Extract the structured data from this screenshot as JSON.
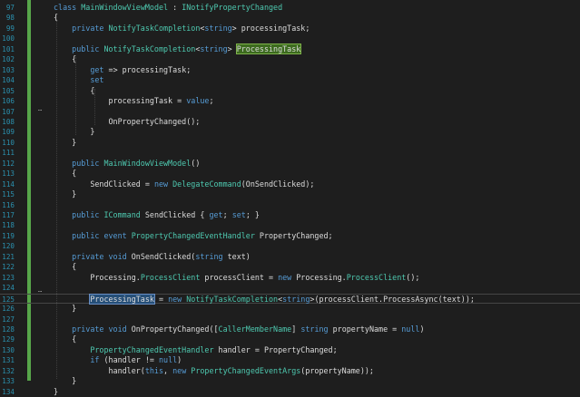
{
  "editor": {
    "lines": [
      {
        "n": "97",
        "tokens": [
          [
            "kw",
            "class "
          ],
          [
            "ty",
            "MainWindowViewModel"
          ],
          [
            "pl",
            " : "
          ],
          [
            "ty",
            "INotifyPropertyChanged"
          ]
        ]
      },
      {
        "n": "98",
        "tokens": [
          [
            "pl",
            "{"
          ]
        ]
      },
      {
        "n": "99",
        "tokens": [
          [
            "pl",
            "    "
          ],
          [
            "kw",
            "private "
          ],
          [
            "ty",
            "NotifyTaskCompletion"
          ],
          [
            "pl",
            "<"
          ],
          [
            "kw",
            "string"
          ],
          [
            "pl",
            "> processingTask;"
          ]
        ]
      },
      {
        "n": "100",
        "tokens": []
      },
      {
        "n": "101",
        "tokens": [
          [
            "pl",
            "    "
          ],
          [
            "kw",
            "public "
          ],
          [
            "ty",
            "NotifyTaskCompletion"
          ],
          [
            "pl",
            "<"
          ],
          [
            "kw",
            "string"
          ],
          [
            "pl",
            "> "
          ],
          [
            "hlg",
            "ProcessingTask"
          ]
        ]
      },
      {
        "n": "102",
        "tokens": [
          [
            "pl",
            "    {"
          ]
        ]
      },
      {
        "n": "103",
        "tokens": [
          [
            "pl",
            "        "
          ],
          [
            "kw",
            "get"
          ],
          [
            "pl",
            " => processingTask;"
          ]
        ]
      },
      {
        "n": "104",
        "tokens": [
          [
            "pl",
            "        "
          ],
          [
            "kw",
            "set"
          ]
        ]
      },
      {
        "n": "105",
        "tokens": [
          [
            "pl",
            "        {"
          ]
        ]
      },
      {
        "n": "106",
        "tokens": [
          [
            "pl",
            "            processingTask = "
          ],
          [
            "kw",
            "value"
          ],
          [
            "pl",
            ";"
          ]
        ]
      },
      {
        "n": "107",
        "tokens": []
      },
      {
        "n": "108",
        "tokens": [
          [
            "pl",
            "            OnPropertyChanged();"
          ]
        ]
      },
      {
        "n": "109",
        "tokens": [
          [
            "pl",
            "        }"
          ]
        ]
      },
      {
        "n": "110",
        "tokens": [
          [
            "pl",
            "    }"
          ]
        ]
      },
      {
        "n": "111",
        "tokens": []
      },
      {
        "n": "112",
        "tokens": [
          [
            "pl",
            "    "
          ],
          [
            "kw",
            "public "
          ],
          [
            "ty",
            "MainWindowViewModel"
          ],
          [
            "pl",
            "()"
          ]
        ]
      },
      {
        "n": "113",
        "tokens": [
          [
            "pl",
            "    {"
          ]
        ]
      },
      {
        "n": "114",
        "tokens": [
          [
            "pl",
            "        SendClicked = "
          ],
          [
            "kw",
            "new "
          ],
          [
            "ty",
            "DelegateCommand"
          ],
          [
            "pl",
            "(OnSendClicked);"
          ]
        ]
      },
      {
        "n": "115",
        "tokens": [
          [
            "pl",
            "    }"
          ]
        ]
      },
      {
        "n": "116",
        "tokens": []
      },
      {
        "n": "117",
        "tokens": [
          [
            "pl",
            "    "
          ],
          [
            "kw",
            "public "
          ],
          [
            "ty",
            "ICommand"
          ],
          [
            "pl",
            " SendClicked { "
          ],
          [
            "kw",
            "get"
          ],
          [
            "pl",
            "; "
          ],
          [
            "kw",
            "set"
          ],
          [
            "pl",
            "; }"
          ]
        ]
      },
      {
        "n": "118",
        "tokens": []
      },
      {
        "n": "119",
        "tokens": [
          [
            "pl",
            "    "
          ],
          [
            "kw",
            "public event "
          ],
          [
            "ty",
            "PropertyChangedEventHandler"
          ],
          [
            "pl",
            " PropertyChanged;"
          ]
        ]
      },
      {
        "n": "120",
        "tokens": []
      },
      {
        "n": "121",
        "tokens": [
          [
            "pl",
            "    "
          ],
          [
            "kw",
            "private void "
          ],
          [
            "pl",
            "OnSendClicked("
          ],
          [
            "kw",
            "string "
          ],
          [
            "pl",
            "text)"
          ]
        ]
      },
      {
        "n": "122",
        "tokens": [
          [
            "pl",
            "    {"
          ]
        ]
      },
      {
        "n": "123",
        "tokens": [
          [
            "pl",
            "        Processing."
          ],
          [
            "ty",
            "ProcessClient"
          ],
          [
            "pl",
            " processClient = "
          ],
          [
            "kw",
            "new "
          ],
          [
            "pl",
            "Processing."
          ],
          [
            "ty",
            "ProcessClient"
          ],
          [
            "pl",
            "();"
          ]
        ]
      },
      {
        "n": "124",
        "tokens": []
      },
      {
        "n": "125",
        "tokens": [
          [
            "pl",
            "        "
          ],
          [
            "hlb",
            "ProcessingTask"
          ],
          [
            "pl",
            " = "
          ],
          [
            "kw",
            "new "
          ],
          [
            "ty",
            "NotifyTaskCompletion"
          ],
          [
            "pl",
            "<"
          ],
          [
            "kw",
            "string"
          ],
          [
            "pl",
            ">(processClient.ProcessAsync(text));"
          ]
        ]
      },
      {
        "n": "126",
        "tokens": [
          [
            "pl",
            "    }"
          ]
        ]
      },
      {
        "n": "127",
        "tokens": []
      },
      {
        "n": "128",
        "tokens": [
          [
            "pl",
            "    "
          ],
          [
            "kw",
            "private void "
          ],
          [
            "pl",
            "OnPropertyChanged(["
          ],
          [
            "ty",
            "CallerMemberName"
          ],
          [
            "pl",
            "] "
          ],
          [
            "kw",
            "string "
          ],
          [
            "pl",
            "propertyName = "
          ],
          [
            "kw",
            "null"
          ],
          [
            "pl",
            ")"
          ]
        ]
      },
      {
        "n": "129",
        "tokens": [
          [
            "pl",
            "    {"
          ]
        ]
      },
      {
        "n": "130",
        "tokens": [
          [
            "pl",
            "        "
          ],
          [
            "ty",
            "PropertyChangedEventHandler"
          ],
          [
            "pl",
            " handler = PropertyChanged;"
          ]
        ]
      },
      {
        "n": "131",
        "tokens": [
          [
            "pl",
            "        "
          ],
          [
            "kw",
            "if "
          ],
          [
            "pl",
            "(handler != "
          ],
          [
            "kw",
            "null"
          ],
          [
            "pl",
            ")"
          ]
        ]
      },
      {
        "n": "132",
        "tokens": [
          [
            "pl",
            "            handler("
          ],
          [
            "kw",
            "this"
          ],
          [
            "pl",
            ", "
          ],
          [
            "kw",
            "new "
          ],
          [
            "ty",
            "PropertyChangedEventArgs"
          ],
          [
            "pl",
            "(propertyName));"
          ]
        ]
      },
      {
        "n": "133",
        "tokens": [
          [
            "pl",
            "    }"
          ]
        ]
      },
      {
        "n": "134",
        "tokens": [
          [
            "pl",
            "}"
          ]
        ]
      }
    ]
  },
  "colors": {
    "background": "#1e1e1e",
    "keyword": "#569cd6",
    "type": "#4ec9b0",
    "plain": "#dcdcdc",
    "line_number": "#2b91af",
    "change_bar": "#57a64a"
  }
}
